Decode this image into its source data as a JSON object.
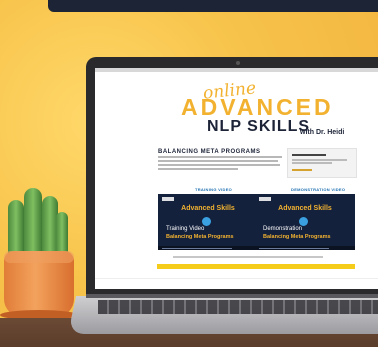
{
  "logo": {
    "script_word": "online",
    "main_word": "ADVANCED",
    "sub_word": "NLP SKILLS",
    "author": "with Dr. Heidi"
  },
  "section": {
    "heading": "BALANCING META PROGRAMS"
  },
  "videos": [
    {
      "label": "TRAINING VIDEO",
      "title": "Advanced Skills",
      "subtitle": "Training Video",
      "topic": "Balancing Meta Programs"
    },
    {
      "label": "DEMONSTRATION VIDEO",
      "title": "Advanced Skills",
      "subtitle": "Demonstration",
      "topic": "Balancing Meta Programs"
    }
  ],
  "colors": {
    "background": "#f6c24a",
    "brand_gold": "#f2b230",
    "brand_navy": "#1d2438",
    "video_bg": "#14213d",
    "highlight_bar": "#f6cc1b"
  },
  "icons": [
    "play-icon",
    "cactus-plant",
    "laptop"
  ]
}
